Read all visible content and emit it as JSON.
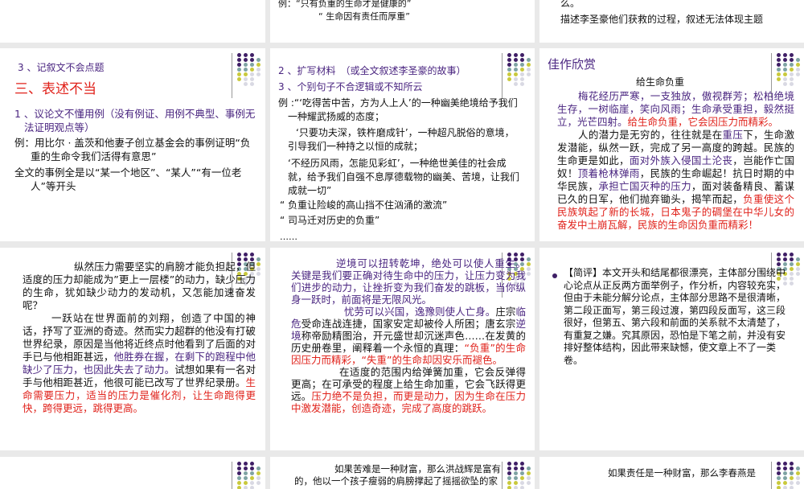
{
  "colors": {
    "purple": "#4a2580",
    "red": "#e0221b",
    "dot_purple": "#3f1f66",
    "dot_teal": "#7fa3a3",
    "dot_yellow": "#c9c93c",
    "dot_gray": "#d9d9e3"
  },
  "row0": {
    "s2": {
      "line1": "例：“只有负重的生命才是健康的”",
      "line2": "“ 生命因有责任而厚重”"
    },
    "s3": {
      "line1": "么。",
      "line2": "描述李圣豪他们获救的过程，叙述无法体现主题"
    }
  },
  "row1": {
    "s1": {
      "item3": "3 、记叙文不会点题",
      "heading": "三、表述不当",
      "item1": "1 、议论文不懂用例（没有例证、用例不典型、事例无法证明观点等）",
      "ex1": "例：用比尔 · 盖茨和他妻子创立基金会的事例证明“负重的生命令我们活得有意思”",
      "ex2": "全文的事例全是以“某一个地区”、“某人”“有一位老人”等开头"
    },
    "s2": {
      "item2": "2 、扩写材料　（或全文叙述李圣豪的故事）",
      "item3": "3 、个别句子不合逻辑或不知所云",
      "ex": "例 :“‘吃得苦中苦，方为人上人’的一种幽美绝境给予我们一种耀武扬威的态度；",
      "q1": "‘只要功夫深，铁杵磨成针’，一种超凡脱俗的意境，引导我们一种持之以恒的成就；",
      "q2": "‘不经历风雨，怎能见彩虹’，一种绝世美佳的社会成就，给予我们自强不息厚德载物的幽美、苦境，让我们成就一切”",
      "q3": "“ 负重让险峻的高山挡不住汹涌的激流”",
      "q4": "“ 司马迁对历史的负重”",
      "ellipsis": "……"
    },
    "s3": {
      "heading": "佳作欣赏",
      "title": "给生命负重",
      "p1": [
        {
          "t": "梅花经历严寒，一支独放，傲视群芳；松柏绝境生存，一树临崖，笑向风雨；生命承受重担，毅然挺立，光芒四射。",
          "c": "purple"
        },
        {
          "t": "给生命负重，它会因压力而精彩。",
          "c": "red"
        }
      ],
      "p2": [
        {
          "t": "人的潜力是无穷的，往往就是在",
          "c": ""
        },
        {
          "t": "重压",
          "c": "purple"
        },
        {
          "t": "下，生命激发潜能，纵然一跃，完成了另一高度的跨越。民族的生命更是如此，",
          "c": ""
        },
        {
          "t": "面对外族入侵国土沦丧",
          "c": "purple"
        },
        {
          "t": "，岂能作亡国奴！",
          "c": ""
        },
        {
          "t": "顶着枪林弹雨",
          "c": "purple"
        },
        {
          "t": "，民族的生命崛起！抗日时期的中华民族，",
          "c": ""
        },
        {
          "t": "承担亡国灭种的压力",
          "c": "purple"
        },
        {
          "t": "，面对装备精良、蓄谋已久的日军，他们抛弃锄头，揭竿而起，",
          "c": ""
        },
        {
          "t": "负重使这个民族筑起了新的长城，日本鬼子的碉堡在中华儿女的奋发中土崩瓦解，民族的生命因负重而精彩！",
          "c": "red"
        }
      ]
    }
  },
  "row2": {
    "s1": {
      "p1": [
        {
          "t": "纵然压力需要坚实的肩膀才能负担起，但适度的压力却能成为”更上一层楼”的动力，缺少压力的生命，犹如缺少动力的发动机，又怎能加速奋发呢？",
          "c": ""
        }
      ],
      "p2": [
        {
          "t": "一跃站在世界面前的刘翔，创造了中国的神话，抒写了亚洲的奇迹。然而实力超群的他没有打破世界纪录，原因是当他将近终点时他看到了后面的对手已与他相距甚远，",
          "c": ""
        },
        {
          "t": "他胜券在握，在剩下的跑程中他缺少了压力，也因此失去了动力。",
          "c": "purple"
        },
        {
          "t": "试想如果有一名对手与他相距甚近，他很可能已改写了世界纪录册。",
          "c": ""
        },
        {
          "t": "生命需要压力，适当的压力是催化剂，让生命跑得更快，跨得更远，跳得更高。",
          "c": "red"
        }
      ]
    },
    "s2": {
      "p1": [
        {
          "t": "逆境可以扭转乾坤，绝处可以使人重生。关键是我们要正确对待生命中的压力，让压力变为我们进步的动力，让挫折变为我们奋发的跳板，当你纵身一跃时，前面将是无限风光。",
          "c": "purple"
        }
      ],
      "p2": [
        {
          "t": "忧劳可以兴国，逸豫则使人亡身。",
          "c": "purple"
        },
        {
          "t": "庄宗",
          "c": ""
        },
        {
          "t": "临危",
          "c": "purple"
        },
        {
          "t": "受命连战连捷，国家安定却被伶人所困；唐玄宗",
          "c": ""
        },
        {
          "t": "逆境",
          "c": "purple"
        },
        {
          "t": "称帝励精图治，开元盛世却沉迷声色……在发黄的历史册卷里，阐释着一个永恒的真理：",
          "c": ""
        },
        {
          "t": "“负重”的生命因压力而精彩，“失重”的生命却因安乐而褪色。",
          "c": "red"
        }
      ],
      "p3": [
        {
          "t": "在适度的范围内给弹簧加重，它会反弹得更高；在可承受的程度上给生命加重，它会飞跃得更远。",
          "c": ""
        },
        {
          "t": "压力绝不是负担，而更是动力，因为生命在压力中激发潜能，创造奇迹，完成了高度的跳跃。",
          "c": "red"
        }
      ]
    },
    "s3": {
      "comment": "【简评】本文开头和结尾都很漂亮，主体部分围绕中心论点从正反两方面举例子，作分析，内容较充实，但由于未能分解分论点，主体部分思路不是很清晰，第二段正面写，第三段过渡，第四段反面写，这三段很好，但第五、第六段和前面的关系就不太清楚了，有重复之嫌。究其原因，恐怕是下笔之前，并没有安排好整体结构，因此带来缺憾，使文章上不了一类卷。"
    }
  },
  "row3": {
    "s2": {
      "line1": "如果苦难是一种财富，那么洪战辉是富有的，他以一个孩子瘦弱的肩膀撑起了摇摇欲坠的家"
    },
    "s3": {
      "line1": "如果责任是一种财富，那么李春燕是"
    }
  }
}
